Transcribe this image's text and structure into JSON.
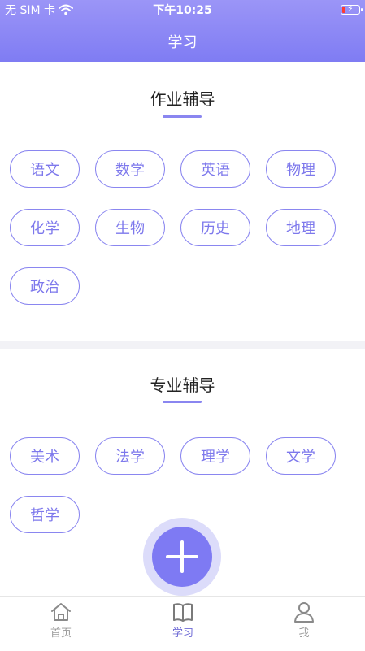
{
  "status_bar": {
    "carrier": "无 SIM 卡",
    "time": "下午10:25",
    "battery_color": "#ff3b30"
  },
  "header": {
    "title": "学习",
    "gradient_top": "#9b95f7",
    "gradient_bottom": "#7f7cf3"
  },
  "sections": [
    {
      "title": "作业辅导",
      "chips": [
        "语文",
        "数学",
        "英语",
        "物理",
        "化学",
        "生物",
        "历史",
        "地理",
        "政治"
      ]
    },
    {
      "title": "专业辅导",
      "chips": [
        "美术",
        "法学",
        "理学",
        "文学",
        "哲学"
      ]
    }
  ],
  "fab": {
    "icon": "plus-icon",
    "color": "#7e7af3"
  },
  "tabbar": {
    "items": [
      {
        "label": "首页",
        "icon": "home-icon",
        "active": false
      },
      {
        "label": "学习",
        "icon": "book-icon",
        "active": true
      },
      {
        "label": "我",
        "icon": "person-icon",
        "active": false
      }
    ],
    "active_color": "#6f6bd6"
  },
  "accent_color": "#8a86f0"
}
